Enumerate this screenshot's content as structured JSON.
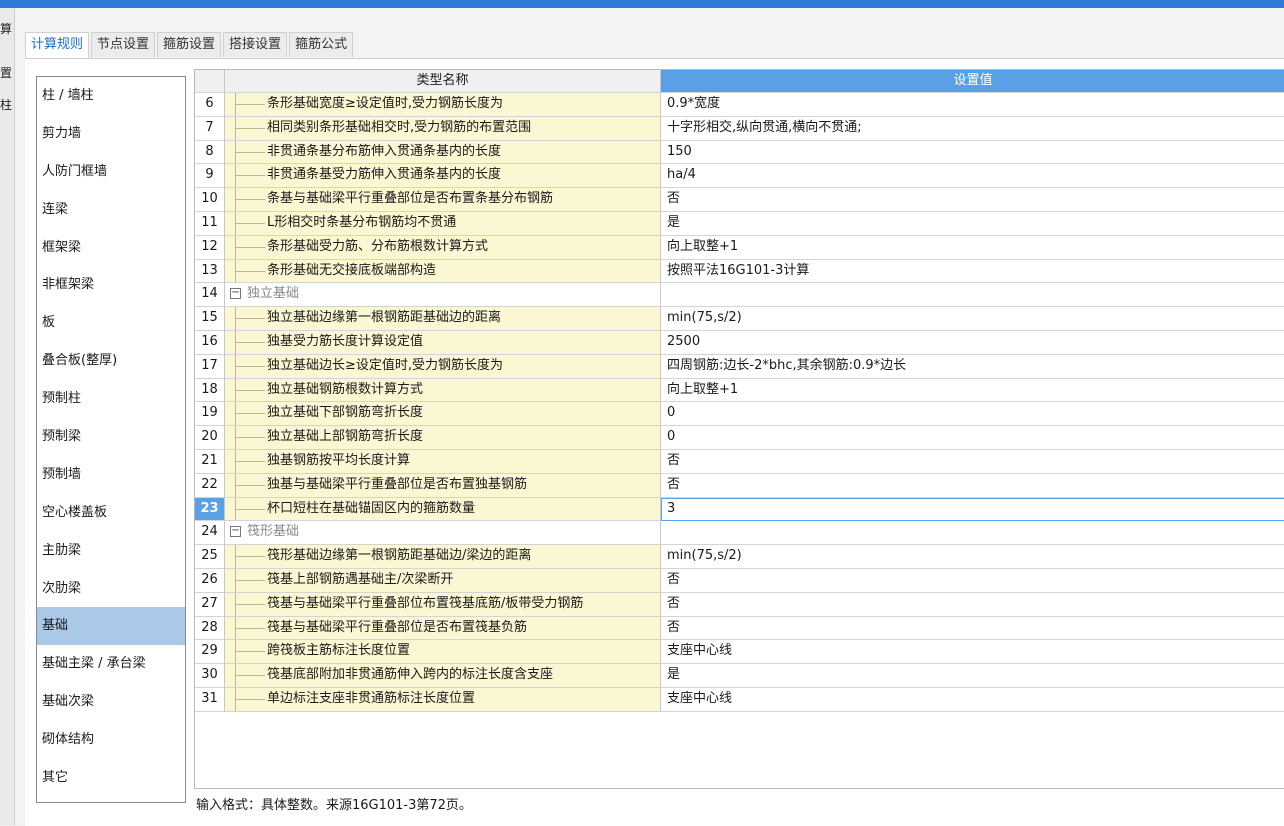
{
  "leftstrip": [
    "算",
    "置",
    "柱"
  ],
  "tabs": [
    "计算规则",
    "节点设置",
    "箍筋设置",
    "搭接设置",
    "箍筋公式"
  ],
  "sidebar": [
    "柱 / 墙柱",
    "剪力墙",
    "人防门框墙",
    "连梁",
    "框架梁",
    "非框架梁",
    "板",
    "叠合板(整厚)",
    "预制柱",
    "预制梁",
    "预制墙",
    "空心楼盖板",
    "主肋梁",
    "次肋梁",
    "基础",
    "基础主梁 / 承台梁",
    "基础次梁",
    "砌体结构",
    "其它"
  ],
  "sidebar_selected": "基础",
  "grid": {
    "header_name": "类型名称",
    "header_value": "设置值",
    "rows": [
      {
        "num": "6",
        "name": "条形基础宽度≥设定值时,受力钢筋长度为",
        "value": "0.9*宽度"
      },
      {
        "num": "7",
        "name": "相同类别条形基础相交时,受力钢筋的布置范围",
        "value": "十字形相交,纵向贯通,横向不贯通;"
      },
      {
        "num": "8",
        "name": "非贯通条基分布筋伸入贯通条基内的长度",
        "value": "150"
      },
      {
        "num": "9",
        "name": "非贯通条基受力筋伸入贯通条基内的长度",
        "value": "ha/4"
      },
      {
        "num": "10",
        "name": "条基与基础梁平行重叠部位是否布置条基分布钢筋",
        "value": "否"
      },
      {
        "num": "11",
        "name": "L形相交时条基分布钢筋均不贯通",
        "value": "是"
      },
      {
        "num": "12",
        "name": "条形基础受力筋、分布筋根数计算方式",
        "value": "向上取整+1"
      },
      {
        "num": "13",
        "name": "条形基础无交接底板端部构造",
        "value": "按照平法16G101-3计算"
      },
      {
        "num": "14",
        "group": true,
        "name": "独立基础",
        "value": ""
      },
      {
        "num": "15",
        "name": "独立基础边缘第一根钢筋距基础边的距离",
        "value": "min(75,s/2)"
      },
      {
        "num": "16",
        "name": "独基受力筋长度计算设定值",
        "value": "2500"
      },
      {
        "num": "17",
        "name": "独立基础边长≥设定值时,受力钢筋长度为",
        "value": "四周钢筋:边长-2*bhc,其余钢筋:0.9*边长"
      },
      {
        "num": "18",
        "name": "独立基础钢筋根数计算方式",
        "value": "向上取整+1"
      },
      {
        "num": "19",
        "name": "独立基础下部钢筋弯折长度",
        "value": "0"
      },
      {
        "num": "20",
        "name": "独立基础上部钢筋弯折长度",
        "value": "0"
      },
      {
        "num": "21",
        "name": "独基钢筋按平均长度计算",
        "value": "否"
      },
      {
        "num": "22",
        "name": "独基与基础梁平行重叠部位是否布置独基钢筋",
        "value": "否"
      },
      {
        "num": "23",
        "current": true,
        "name": "杯口短柱在基础锚固区内的箍筋数量",
        "value": "3"
      },
      {
        "num": "24",
        "group": true,
        "name": "筏形基础",
        "value": ""
      },
      {
        "num": "25",
        "name": "筏形基础边缘第一根钢筋距基础边/梁边的距离",
        "value": "min(75,s/2)"
      },
      {
        "num": "26",
        "name": "筏基上部钢筋遇基础主/次梁断开",
        "value": "否"
      },
      {
        "num": "27",
        "name": "筏基与基础梁平行重叠部位布置筏基底筋/板带受力钢筋",
        "value": "否"
      },
      {
        "num": "28",
        "name": "筏基与基础梁平行重叠部位是否布置筏基负筋",
        "value": "否"
      },
      {
        "num": "29",
        "name": "跨筏板主筋标注长度位置",
        "value": "支座中心线"
      },
      {
        "num": "30",
        "name": "筏基底部附加非贯通筋伸入跨内的标注长度含支座",
        "value": "是"
      },
      {
        "num": "31",
        "name": "单边标注支座非贯通筋标注长度位置",
        "value": "支座中心线"
      }
    ]
  },
  "hint": "输入格式：具体整数。来源16G101-3第72页。"
}
